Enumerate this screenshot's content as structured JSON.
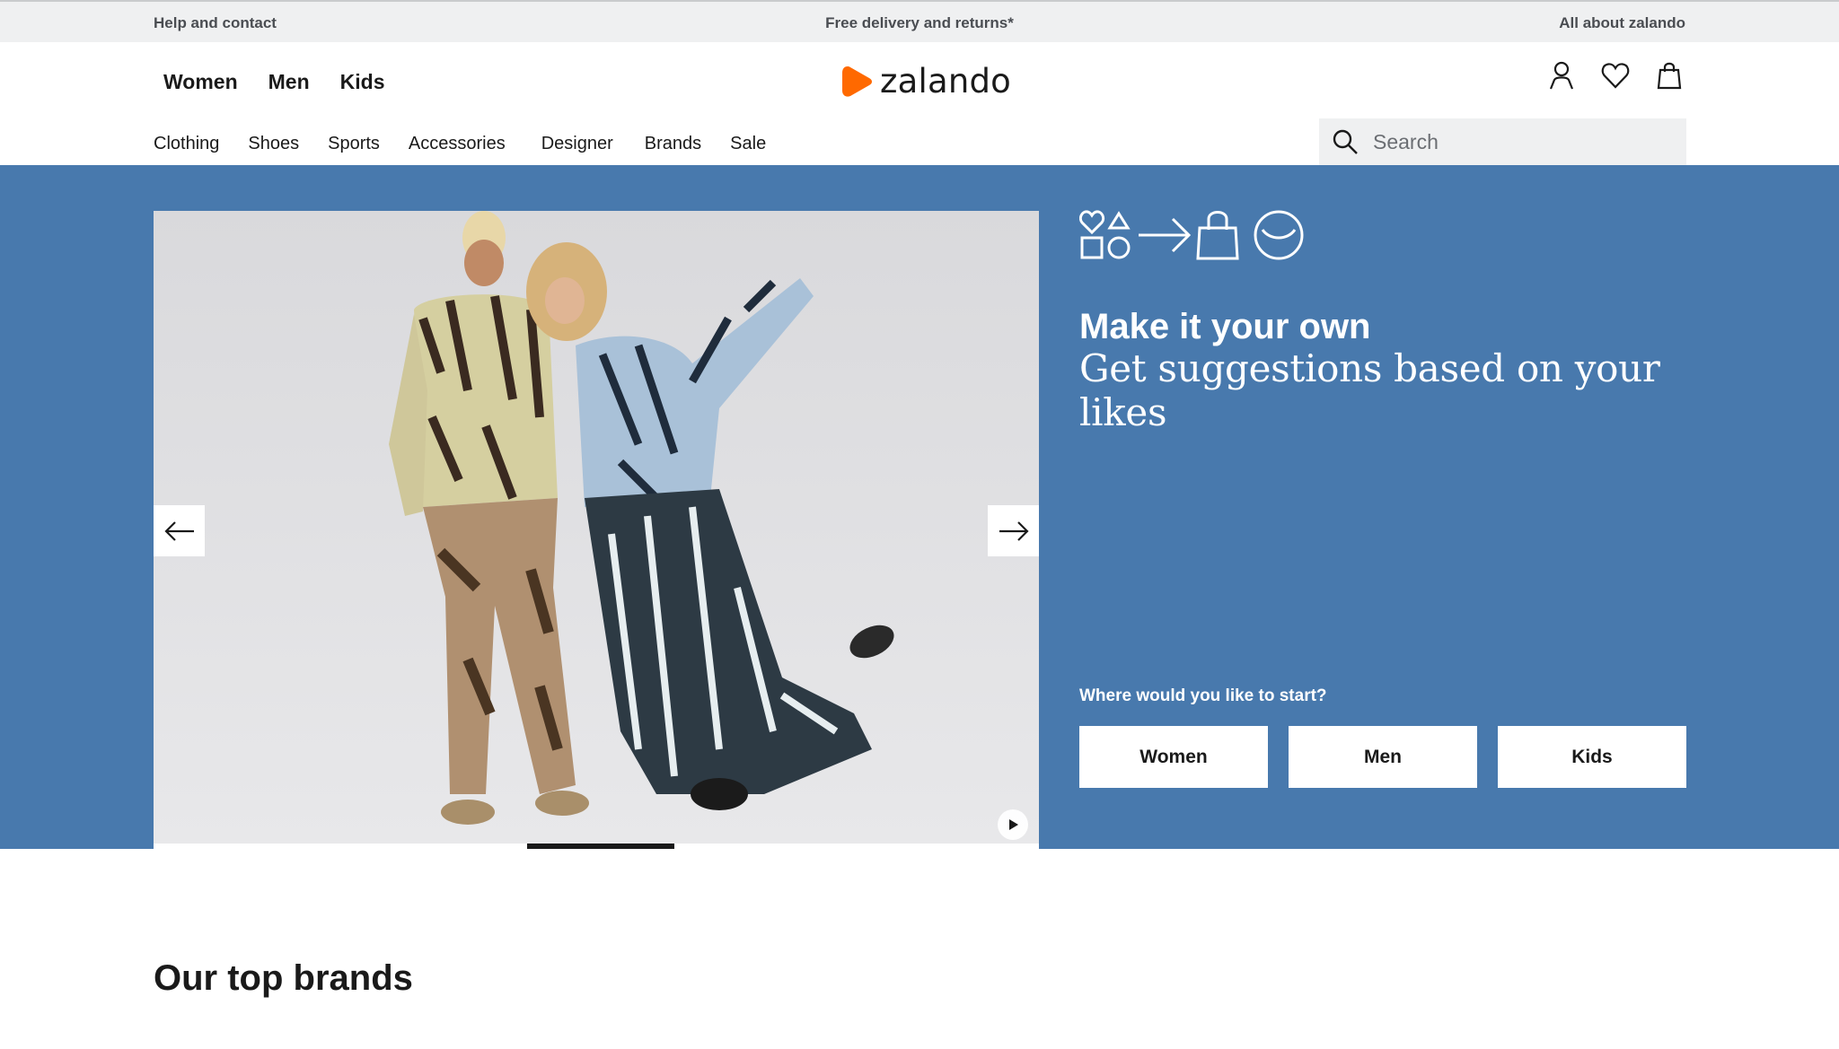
{
  "topbar": {
    "help": "Help and contact",
    "delivery": "Free delivery and returns*",
    "about": "All about zalando"
  },
  "header": {
    "gender_nav": [
      "Women",
      "Men",
      "Kids"
    ],
    "logo_text": "zalando",
    "icons": [
      "user-icon",
      "heart-icon",
      "bag-icon"
    ],
    "category_nav": [
      "Clothing",
      "Shoes",
      "Sports",
      "Accessories",
      "Designer",
      "Brands",
      "Sale"
    ],
    "search_placeholder": "Search"
  },
  "hero": {
    "title": "Make it your own",
    "subtitle": "Get suggestions based on your likes",
    "question": "Where would you like to start?",
    "choices": [
      "Women",
      "Men",
      "Kids"
    ],
    "carousel_progress": 0.5,
    "colors": {
      "background": "#4879ad",
      "brand_orange": "#ff6900"
    },
    "icons": [
      "heart-shapes-icon",
      "arrow-right-icon",
      "shopping-bag-icon",
      "smile-icon",
      "arrow-left-icon",
      "play-icon"
    ]
  },
  "brands": {
    "title": "Our top brands"
  }
}
